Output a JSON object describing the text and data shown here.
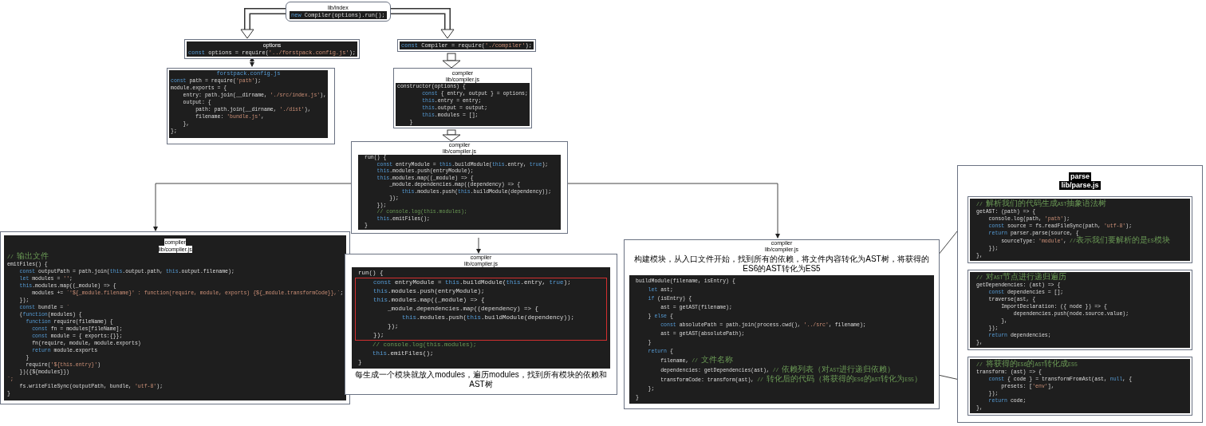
{
  "nodes": [
    {
      "title": [
        "lib/index"
      ],
      "code": [
        "new Compiler(options).run();"
      ]
    },
    {
      "title": [
        "options"
      ],
      "code": [
        "const options = require('../forstpack.config.js');"
      ]
    },
    {
      "title": [
        "forstpack.config.js"
      ],
      "code": [
        "const path = require('path');",
        "module.exports = {",
        "    entry: path.join(__dirname, './src/index.js'),",
        "    output: {",
        "        path: path.join(__dirname, './dist'),",
        "        filename: 'bundle.js',",
        "    },",
        "};"
      ]
    },
    {
      "code": [
        "const Compiler = require('./compiler');"
      ]
    },
    {
      "title": [
        "compiler",
        "lib/compiler.js"
      ],
      "code": [
        "constructor(options) {",
        "        const { entry, output } = options;",
        "        this.entry = entry;",
        "        this.output = output;",
        "        this.modules = [];",
        "    }"
      ]
    },
    {
      "title": [
        "compiler",
        "lib/compiler.js"
      ],
      "code": [
        "run() {",
        "    const entryModule = this.buildModule(this.entry, true);",
        "    this.modules.push(entryModule);",
        "    this.modules.map((_module) => {",
        "        _module.dependencies.map((dependency) => {",
        "            this.modules.push(this.buildModule(dependency));",
        "        });",
        "    });",
        "    // console.log(this.modules);",
        "    this.emitFiles();",
        "}"
      ]
    },
    {
      "title": [
        "compiler",
        "lib/compiler.js"
      ],
      "code": [
        "// 输出文件",
        "emitFiles() {",
        "    const outputPath = path.join(this.output.path, this.output.filename);",
        "    let modules = '';",
        "    this.modules.map((_module) => {",
        "        modules += `'${_module.filename}' : function(require, module, exports) {${_module.transformCode}},`;",
        "    });",
        "    const bundle = `",
        "    (function(modules) {",
        "      function require(fileName) {",
        "        const fn = modules[fileName];",
        "        const module = { exports:{}};",
        "        fn(require, module, module.exports)",
        "        return module.exports",
        "      }",
        "      require('${this.entry}')",
        "    })({${modules}})",
        "`;",
        "    fs.writeFileSync(outputPath, bundle, 'utf-8');",
        "}"
      ]
    },
    {
      "title": [
        "compiler",
        "lib/compiler.js"
      ],
      "code": [
        "run() {",
        "    const entryModule = this.buildModule(this.entry, true);",
        "    this.modules.push(entryModule);",
        "    this.modules.map((_module) => {",
        "        _module.dependencies.map((dependency) => {",
        "            this.modules.push(this.buildModule(dependency));",
        "        });",
        "    });",
        "    // console.log(this.modules);",
        "    this.emitFiles();",
        "}"
      ],
      "caption": "每生成一个模块就放入modules，遍历modules，找到所有模块的依赖和AST树"
    },
    {
      "title": [
        "compiler",
        "lib/compiler.js"
      ],
      "caption": "构建模块，从入口文件开始，找到所有的依赖，将文件内容转化为AST树，将获得的ES6的AST转化为ES5",
      "code": [
        "buildModule(filename, isEntry) {",
        "    let ast;",
        "    if (isEntry) {",
        "        ast = getAST(filename);",
        "    } else {",
        "        const absolutePath = path.join(process.cwd(), '../src', filename);",
        "        ast = getAST(absolutePath);",
        "    }",
        "    return {",
        "        filename, // 文件名称",
        "        dependencies: getDependencies(ast), // 依赖列表（对AST进行递归依赖）",
        "        transformCode: transform(ast), // 转化后的代码（将获得的ES6的AST转化为ES5）",
        "    };",
        "}"
      ]
    }
  ],
  "parse": {
    "title": [
      "parse",
      "lib/parse.js"
    ],
    "blocks": [
      {
        "code": [
          "// 解析我们的代码生成AST抽象语法树",
          "getAST: (path) => {",
          "    console.log(path, 'path');",
          "    const source = fs.readFileSync(path, 'utf-8');",
          "    return parser.parse(source, {",
          "        sourceType: 'module', //表示我们要解析的是ES模块",
          "    });",
          "},"
        ]
      },
      {
        "code": [
          "// 对AST节点进行递归遍历",
          "getDependencies: (ast) => {",
          "    const dependencies = [];",
          "    traverse(ast, {",
          "        ImportDeclaration: ({ node }) => {",
          "            dependencies.push(node.source.value);",
          "        },",
          "    });",
          "    return dependencies;",
          "},"
        ]
      },
      {
        "code": [
          "// 将获得的ES6的AST转化成ES5",
          "transform: (ast) => {",
          "    const { code } = transformFromAst(ast, null, {",
          "        presets: ['env'],",
          "    });",
          "    return code;",
          "},"
        ]
      }
    ]
  }
}
